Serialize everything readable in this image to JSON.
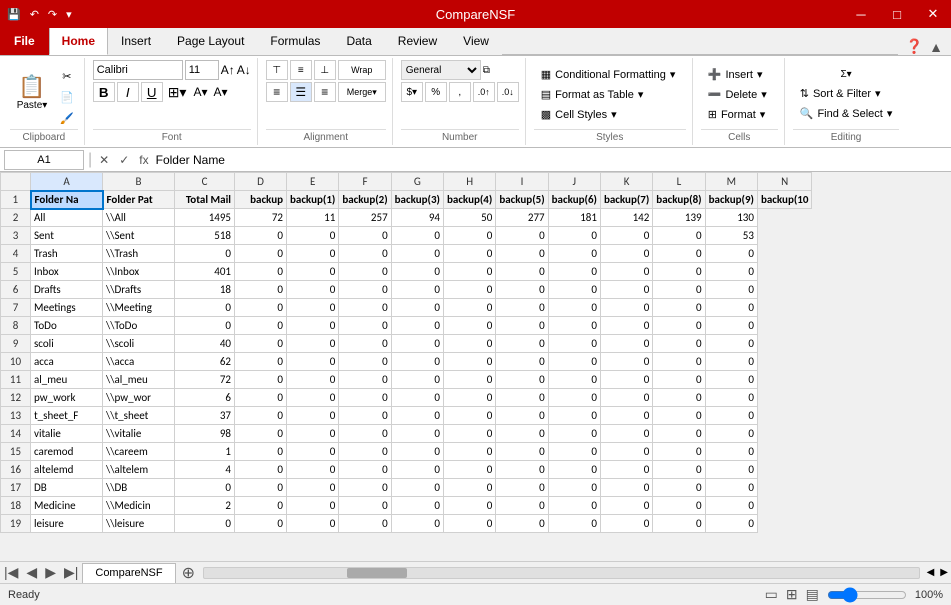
{
  "titleBar": {
    "title": "CompareNSF",
    "minimize": "─",
    "maximize": "□",
    "close": "✕"
  },
  "quickAccess": [
    "💾",
    "↶",
    "↷",
    "▾"
  ],
  "ribbonTabs": [
    "File",
    "Home",
    "Insert",
    "Page Layout",
    "Formulas",
    "Data",
    "Review",
    "View"
  ],
  "activeTab": "Home",
  "ribbon": {
    "groups": {
      "clipboard": "Clipboard",
      "font": "Font",
      "alignment": "Alignment",
      "number": "Number",
      "styles": "Styles",
      "cells": "Cells",
      "editing": "Editing"
    },
    "conditionalFormatting": "Conditional Formatting",
    "formatAsTable": "Format as Table",
    "cellStyles": "Cell Styles",
    "format": "Format",
    "insert": "Insert",
    "delete": "Delete",
    "sortFilter": "Sort & Filter",
    "findSelect": "Find & Select"
  },
  "formulaBar": {
    "cellRef": "A1",
    "formula": "Folder Name"
  },
  "columns": [
    "A",
    "B",
    "C",
    "D",
    "E",
    "F",
    "G",
    "H",
    "I",
    "J",
    "K",
    "L",
    "M",
    "N"
  ],
  "headers": [
    "Folder Na",
    "Folder Pat",
    "Total Mail",
    "backup",
    "backup(1)",
    "backup(2)",
    "backup(3)",
    "backup(4)",
    "backup(5)",
    "backup(6)",
    "backup(7)",
    "backup(8)",
    "backup(9)",
    "backup(10"
  ],
  "rows": [
    [
      "1",
      "Folder Na",
      "Folder Pat",
      "Total Mail",
      "backup",
      "backup(1)",
      "backup(2)",
      "backup(3)",
      "backup(4)",
      "backup(5)",
      "backup(6)",
      "backup(7)",
      "backup(8)",
      "backup(9)",
      "backup(10"
    ],
    [
      "2",
      "All",
      "\\\\All",
      "1495",
      "72",
      "11",
      "257",
      "94",
      "50",
      "277",
      "181",
      "142",
      "139",
      "130"
    ],
    [
      "3",
      "Sent",
      "\\\\Sent",
      "518",
      "0",
      "0",
      "0",
      "0",
      "0",
      "0",
      "0",
      "0",
      "0",
      "53"
    ],
    [
      "4",
      "Trash",
      "\\\\Trash",
      "0",
      "0",
      "0",
      "0",
      "0",
      "0",
      "0",
      "0",
      "0",
      "0",
      "0"
    ],
    [
      "5",
      "Inbox",
      "\\\\Inbox",
      "401",
      "0",
      "0",
      "0",
      "0",
      "0",
      "0",
      "0",
      "0",
      "0",
      "0"
    ],
    [
      "6",
      "Drafts",
      "\\\\Drafts",
      "18",
      "0",
      "0",
      "0",
      "0",
      "0",
      "0",
      "0",
      "0",
      "0",
      "0"
    ],
    [
      "7",
      "Meetings",
      "\\\\Meeting",
      "0",
      "0",
      "0",
      "0",
      "0",
      "0",
      "0",
      "0",
      "0",
      "0",
      "0"
    ],
    [
      "8",
      "ToDo",
      "\\\\ToDo",
      "0",
      "0",
      "0",
      "0",
      "0",
      "0",
      "0",
      "0",
      "0",
      "0",
      "0"
    ],
    [
      "9",
      "scoli",
      "\\\\scoli",
      "40",
      "0",
      "0",
      "0",
      "0",
      "0",
      "0",
      "0",
      "0",
      "0",
      "0"
    ],
    [
      "10",
      "acca",
      "\\\\acca",
      "62",
      "0",
      "0",
      "0",
      "0",
      "0",
      "0",
      "0",
      "0",
      "0",
      "0"
    ],
    [
      "11",
      "al_meu",
      "\\\\al_meu",
      "72",
      "0",
      "0",
      "0",
      "0",
      "0",
      "0",
      "0",
      "0",
      "0",
      "0"
    ],
    [
      "12",
      "pw_work",
      "\\\\pw_wor",
      "6",
      "0",
      "0",
      "0",
      "0",
      "0",
      "0",
      "0",
      "0",
      "0",
      "0"
    ],
    [
      "13",
      "t_sheet_F",
      "\\\\t_sheet",
      "37",
      "0",
      "0",
      "0",
      "0",
      "0",
      "0",
      "0",
      "0",
      "0",
      "0"
    ],
    [
      "14",
      "vitalie",
      "\\\\vitalie",
      "98",
      "0",
      "0",
      "0",
      "0",
      "0",
      "0",
      "0",
      "0",
      "0",
      "0"
    ],
    [
      "15",
      "caremod",
      "\\\\careem",
      "1",
      "0",
      "0",
      "0",
      "0",
      "0",
      "0",
      "0",
      "0",
      "0",
      "0"
    ],
    [
      "16",
      "altelemd",
      "\\\\altelem",
      "4",
      "0",
      "0",
      "0",
      "0",
      "0",
      "0",
      "0",
      "0",
      "0",
      "0"
    ],
    [
      "17",
      "DB",
      "\\\\DB",
      "0",
      "0",
      "0",
      "0",
      "0",
      "0",
      "0",
      "0",
      "0",
      "0",
      "0"
    ],
    [
      "18",
      "Medicine",
      "\\\\Medicin",
      "2",
      "0",
      "0",
      "0",
      "0",
      "0",
      "0",
      "0",
      "0",
      "0",
      "0"
    ],
    [
      "19",
      "leisure",
      "\\\\leisure",
      "0",
      "0",
      "0",
      "0",
      "0",
      "0",
      "0",
      "0",
      "0",
      "0",
      "0"
    ]
  ],
  "sheetTab": "CompareNSF",
  "statusBar": {
    "ready": "Ready",
    "zoom": "100%"
  },
  "fontName": "Calibri",
  "fontSize": "11"
}
